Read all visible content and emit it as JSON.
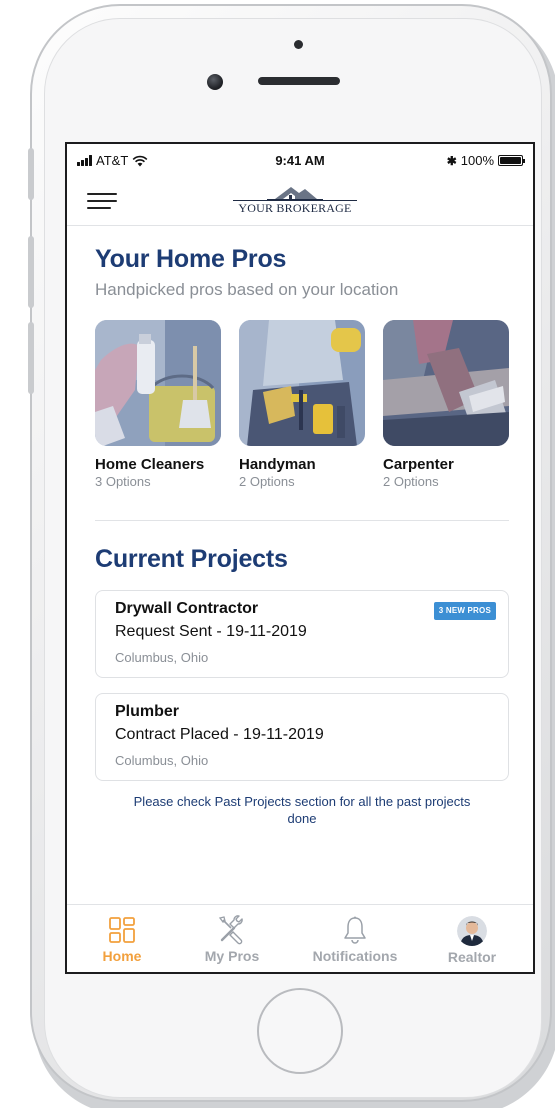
{
  "status_bar": {
    "carrier": "AT&T",
    "time": "9:41 AM",
    "battery": "100%",
    "battery_level": 1.0
  },
  "header": {
    "brand": "YOUR BROKERAGE",
    "menu_icon": "hamburger-menu-icon",
    "logo_icon": "house-roof-icon"
  },
  "home_pros": {
    "title": "Your Home Pros",
    "subtitle": "Handpicked pros based on your location",
    "items": [
      {
        "name": "Home Cleaners",
        "options": "3 Options"
      },
      {
        "name": "Handyman",
        "options": "2 Options"
      },
      {
        "name": "Carpenter",
        "options": "2 Options"
      }
    ]
  },
  "current_projects": {
    "title": "Current Projects",
    "items": [
      {
        "name": "Drywall Contractor",
        "status": "Request Sent - 19-11-2019",
        "location": "Columbus, Ohio",
        "badge": "3 NEW PROS"
      },
      {
        "name": "Plumber",
        "status": "Contract Placed - 19-11-2019",
        "location": "Columbus, Ohio",
        "badge": ""
      }
    ],
    "past_note": "Please check Past Projects section for all the past projects done"
  },
  "tabs": [
    {
      "label": "Home",
      "icon": "grid-icon",
      "active": true
    },
    {
      "label": "My Pros",
      "icon": "tools-icon",
      "active": false
    },
    {
      "label": "Notifications",
      "icon": "bell-icon",
      "active": false
    },
    {
      "label": "Realtor",
      "icon": "avatar",
      "active": false
    }
  ],
  "colors": {
    "title": "#1d3c74",
    "accent": "#f2a03d",
    "badge": "#3c8fd4",
    "muted": "#8a8f96"
  }
}
